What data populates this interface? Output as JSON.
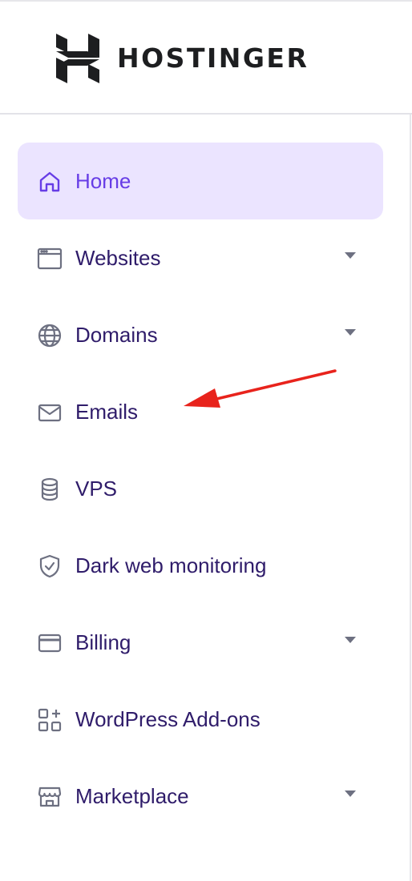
{
  "brand": {
    "name": "HOSTINGER"
  },
  "colors": {
    "accent": "#673de6",
    "active_bg": "#ebe4ff",
    "text": "#2f1c6a",
    "icon": "#6d7081",
    "annotation_arrow": "#e8231c"
  },
  "sidebar": {
    "items": [
      {
        "label": "Home",
        "icon": "home-icon",
        "active": true,
        "has_dropdown": false
      },
      {
        "label": "Websites",
        "icon": "browser-window-icon",
        "active": false,
        "has_dropdown": true
      },
      {
        "label": "Domains",
        "icon": "globe-icon",
        "active": false,
        "has_dropdown": true
      },
      {
        "label": "Emails",
        "icon": "envelope-icon",
        "active": false,
        "has_dropdown": false
      },
      {
        "label": "VPS",
        "icon": "database-icon",
        "active": false,
        "has_dropdown": false
      },
      {
        "label": "Dark web monitoring",
        "icon": "shield-check-icon",
        "active": false,
        "has_dropdown": false
      },
      {
        "label": "Billing",
        "icon": "credit-card-icon",
        "active": false,
        "has_dropdown": true
      },
      {
        "label": "WordPress Add-ons",
        "icon": "add-ons-grid-icon",
        "active": false,
        "has_dropdown": false
      },
      {
        "label": "Marketplace",
        "icon": "storefront-icon",
        "active": false,
        "has_dropdown": true
      }
    ]
  },
  "annotation": {
    "type": "arrow",
    "points_to": "Emails"
  }
}
